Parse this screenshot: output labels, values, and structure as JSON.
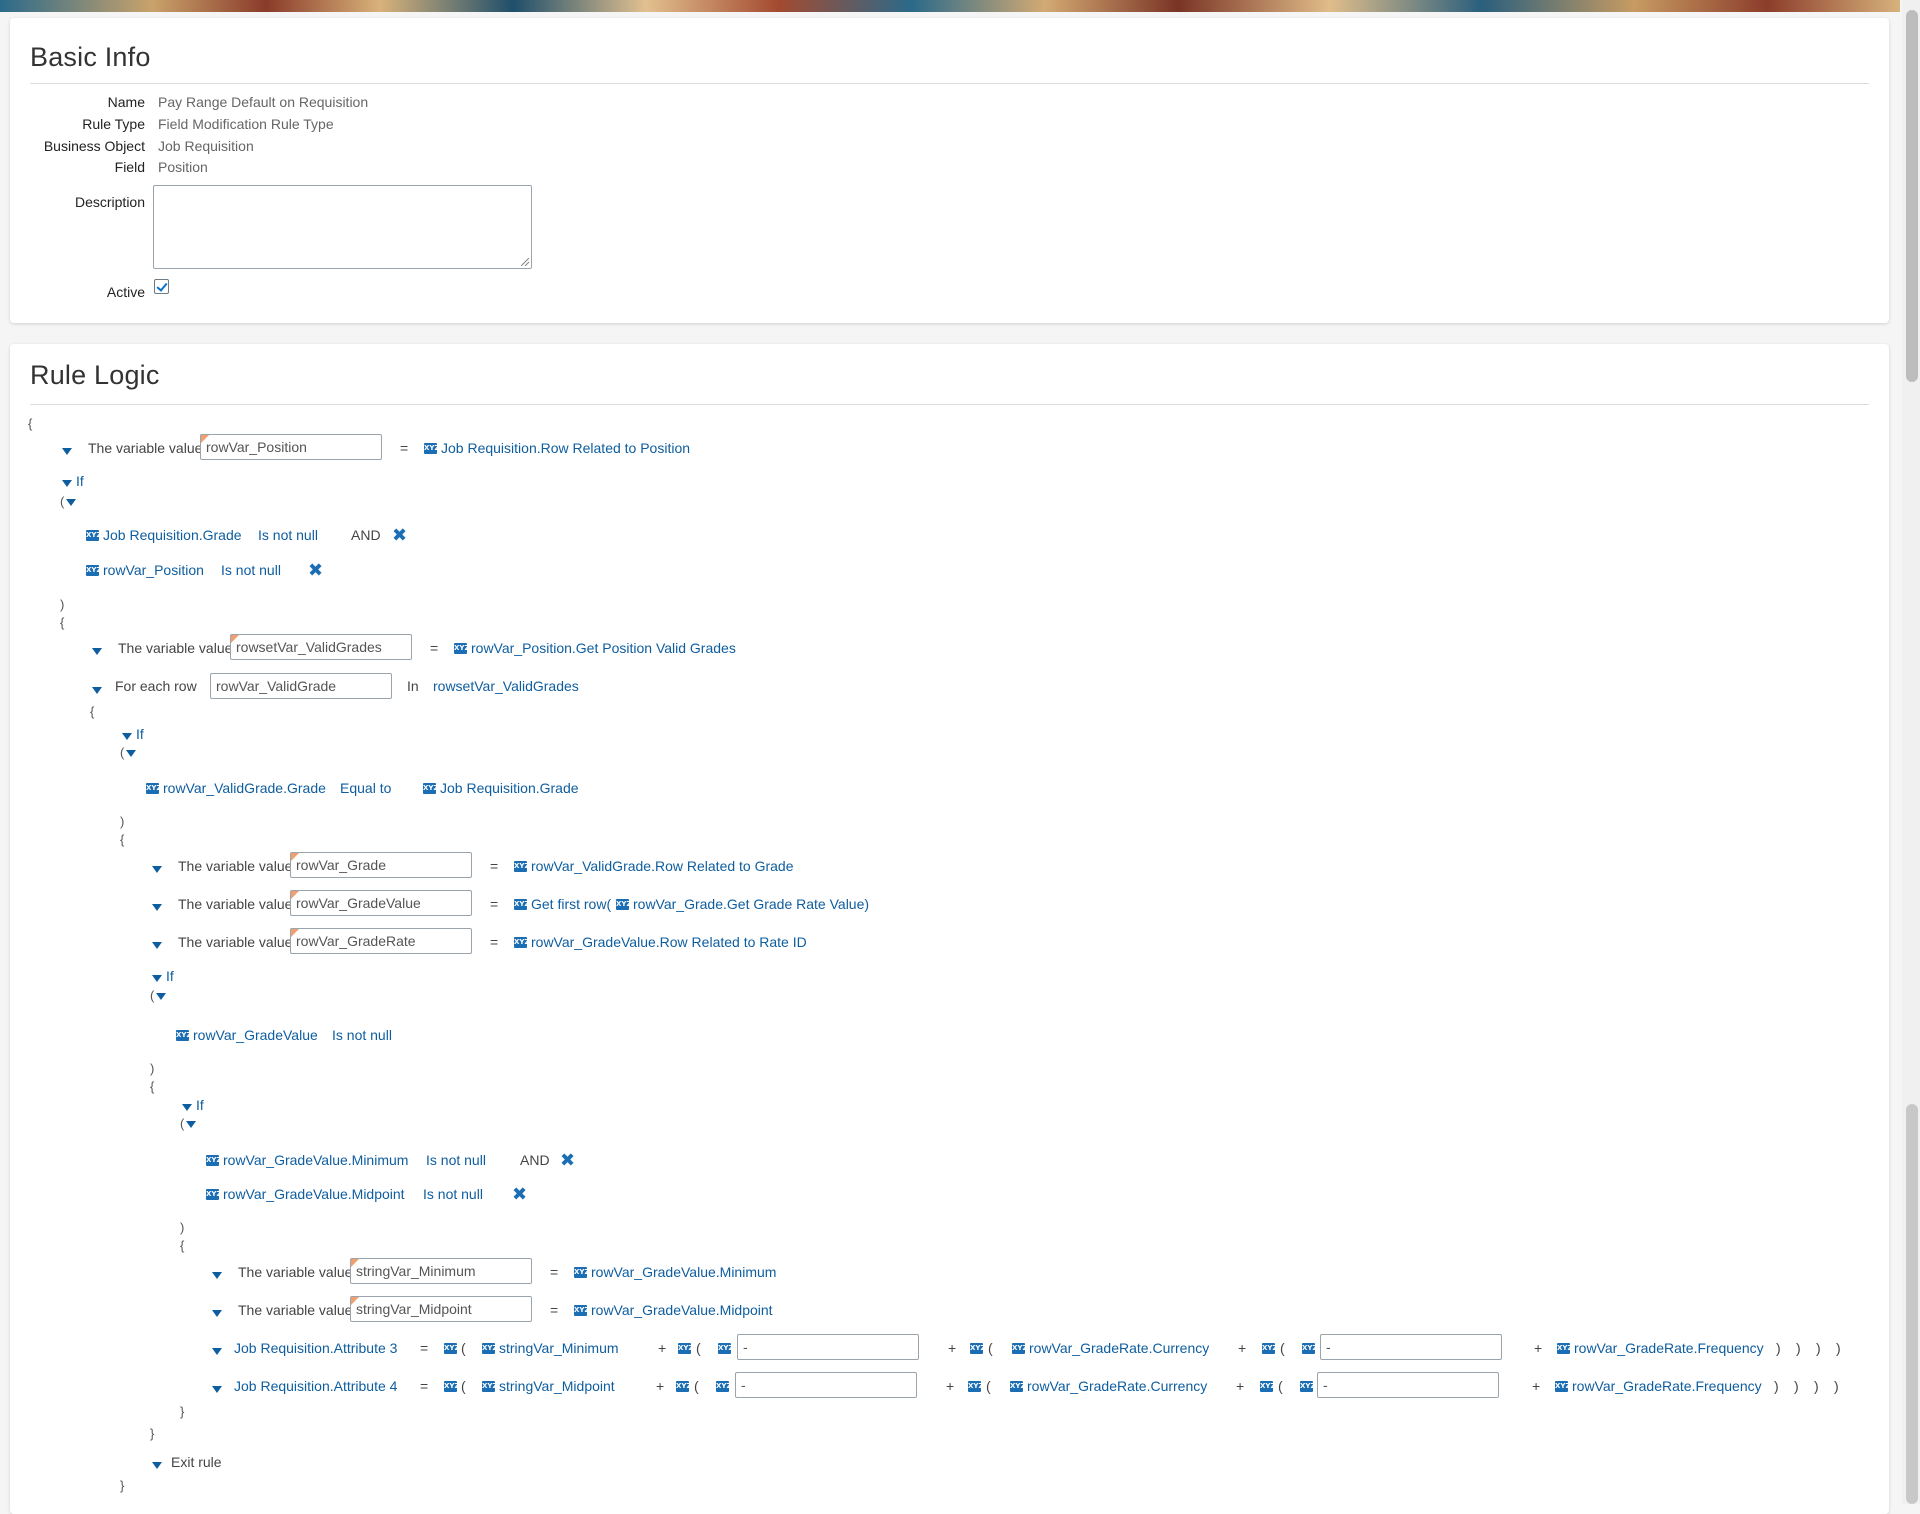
{
  "basic": {
    "title": "Basic Info",
    "fields": [
      {
        "label": "Name",
        "value": "Pay Range Default on Requisition"
      },
      {
        "label": "Rule Type",
        "value": "Field Modification Rule Type"
      },
      {
        "label": "Business Object",
        "value": "Job Requisition"
      },
      {
        "label": "Field",
        "value": "Position"
      }
    ],
    "description_label": "Description",
    "description_value": "",
    "active_label": "Active",
    "active": true
  },
  "logic": {
    "title": "Rule Logic",
    "kw_variable": "The variable value",
    "kw_if": "If",
    "kw_foreach": "For each row",
    "kw_in": "In",
    "kw_and": "AND",
    "kw_isnotnull": "Is not null",
    "kw_equal": "Equal to",
    "kw_exit": "Exit rule",
    "eq": "=",
    "plus": "+",
    "open_paren": "(",
    "close_paren": ")",
    "open_brace": "{",
    "close_brace": "}",
    "dash": "-",
    "icon_text": "XYZ",
    "v1": {
      "var": "rowVar_Position",
      "expr": "Job Requisition.Row Related to Position"
    },
    "if1": {
      "c1": "Job Requisition.Grade",
      "c2": "rowVar_Position"
    },
    "v2": {
      "var": "rowsetVar_ValidGrades",
      "expr": "rowVar_Position.Get Position Valid Grades"
    },
    "foreach": {
      "var": "rowVar_ValidGrade",
      "set": "rowsetVar_ValidGrades"
    },
    "if2": {
      "left": "rowVar_ValidGrade.Grade",
      "right": "Job Requisition.Grade"
    },
    "v3": {
      "var": "rowVar_Grade",
      "expr": "rowVar_ValidGrade.Row Related to Grade"
    },
    "v4": {
      "var": "rowVar_GradeValue",
      "expr_a": "Get first row(",
      "expr_b": "rowVar_Grade.Get Grade Rate Value)"
    },
    "v5": {
      "var": "rowVar_GradeRate",
      "expr": "rowVar_GradeValue.Row Related to Rate ID"
    },
    "if3": {
      "c1": "rowVar_GradeValue"
    },
    "if4": {
      "c1": "rowVar_GradeValue.Minimum",
      "c2": "rowVar_GradeValue.Midpoint"
    },
    "v6": {
      "var": "stringVar_Minimum",
      "expr": "rowVar_GradeValue.Minimum"
    },
    "v7": {
      "var": "stringVar_Midpoint",
      "expr": "rowVar_GradeValue.Midpoint"
    },
    "a3": {
      "target": "Job Requisition.Attribute 3",
      "s": "stringVar_Minimum",
      "cur": "rowVar_GradeRate.Currency",
      "freq": "rowVar_GradeRate.Frequency"
    },
    "a4": {
      "target": "Job Requisition.Attribute 4",
      "s": "stringVar_Midpoint",
      "cur": "rowVar_GradeRate.Currency",
      "freq": "rowVar_GradeRate.Frequency"
    }
  },
  "colors": {
    "link": "#0e5d9f",
    "icon": "#1c6eb4",
    "flag": "#f0a070"
  }
}
